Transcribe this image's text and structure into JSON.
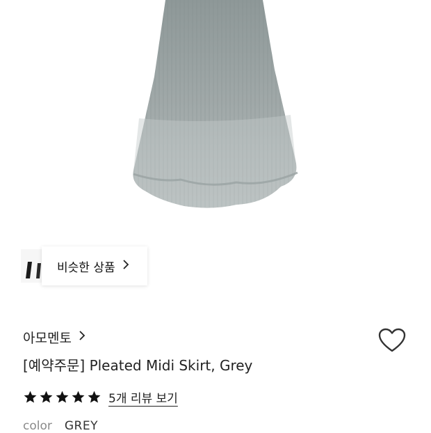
{
  "product": {
    "similar_products_label": "비슷한 상품",
    "brand": "아모멘토",
    "title": "[예약주문] Pleated Midi Skirt, Grey",
    "rating": 5,
    "rating_max": 5,
    "review_link": "5개 리뷰 보기",
    "color_label": "color",
    "color_value": "GREY"
  },
  "icons": {
    "similar_chevron": "chevron-right-icon",
    "brand_chevron": "chevron-right-icon",
    "wishlist": "heart-outline-icon",
    "star": "star-filled-icon"
  },
  "colors": {
    "skirt": "#9aa3a3",
    "text": "#222222",
    "muted": "#8a8a8a"
  }
}
